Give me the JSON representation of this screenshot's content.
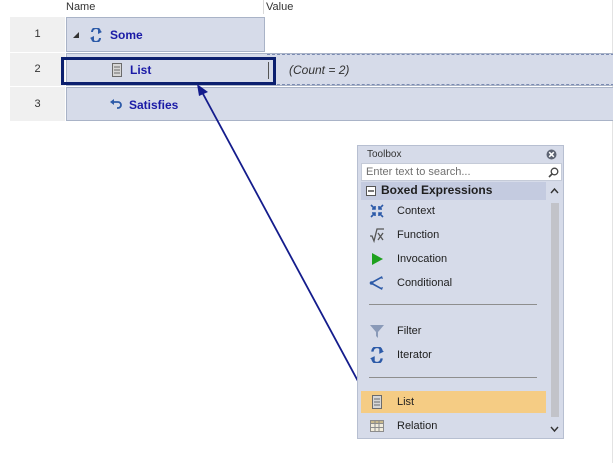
{
  "grid": {
    "columns": {
      "name": "Name",
      "value": "Value"
    },
    "rows": [
      {
        "number": "1",
        "label": "Some",
        "icon": "iterator-icon",
        "value": ""
      },
      {
        "number": "2",
        "label": "List",
        "icon": "list-icon",
        "value": "(Count = 2)"
      },
      {
        "number": "3",
        "label": "Satisfies",
        "icon": "return-arrow-icon",
        "value": ""
      }
    ]
  },
  "toolbox": {
    "title": "Toolbox",
    "search_placeholder": "Enter text to search...",
    "group_label": "Boxed Expressions",
    "items": [
      {
        "label": "Context",
        "icon": "context-icon"
      },
      {
        "label": "Function",
        "icon": "function-icon"
      },
      {
        "label": "Invocation",
        "icon": "invocation-icon"
      },
      {
        "label": "Conditional",
        "icon": "conditional-icon"
      },
      {
        "label": "Filter",
        "icon": "filter-icon"
      },
      {
        "label": "Iterator",
        "icon": "iterator-icon"
      },
      {
        "label": "List",
        "icon": "list-icon",
        "selected": true
      },
      {
        "label": "Relation",
        "icon": "relation-icon"
      }
    ]
  },
  "colors": {
    "cell_bg": "#d6dbe9",
    "label_blue": "#1a1aa6",
    "selection_border": "#0b1f6e",
    "drag_arrow": "#141c8c",
    "selected_item_bg": "#f5cc84"
  }
}
